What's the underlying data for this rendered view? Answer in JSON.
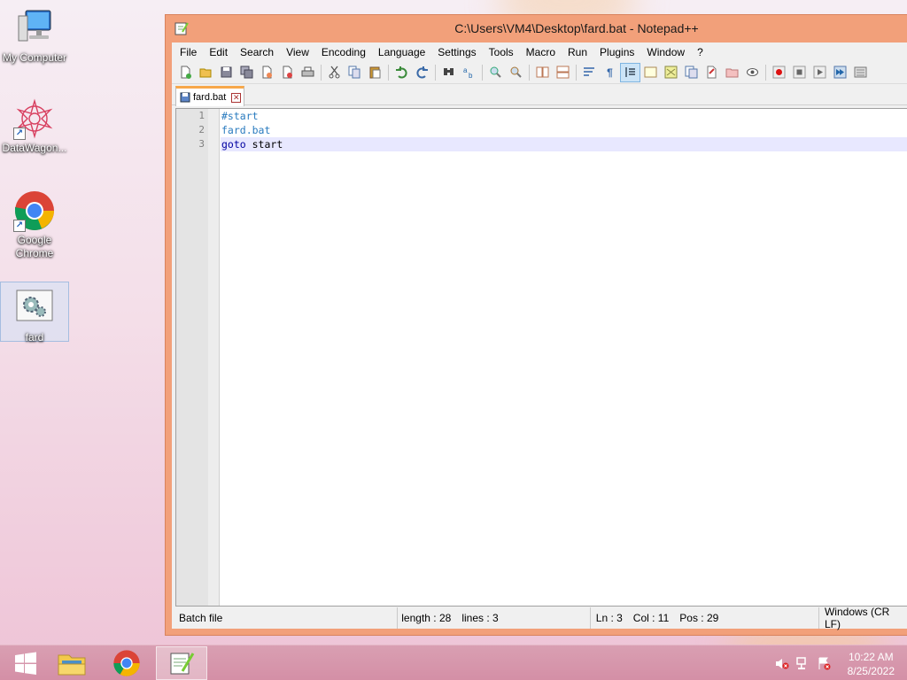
{
  "desktop": {
    "icons": [
      {
        "label": "My Computer"
      },
      {
        "label": "DataWagon..."
      },
      {
        "label": "Google Chrome"
      },
      {
        "label": "fard"
      }
    ]
  },
  "window": {
    "title": "C:\\Users\\VM4\\Desktop\\fard.bat - Notepad++",
    "menu": [
      "File",
      "Edit",
      "Search",
      "View",
      "Encoding",
      "Language",
      "Settings",
      "Tools",
      "Macro",
      "Run",
      "Plugins",
      "Window",
      "?"
    ],
    "tab": {
      "label": "fard.bat"
    },
    "lines": [
      {
        "number": "1",
        "text": "#start"
      },
      {
        "number": "2",
        "text": "fard.bat"
      },
      {
        "number": "3",
        "keyword": "goto",
        "text": " start"
      }
    ],
    "status": {
      "language": "Batch file",
      "length": "length : 28",
      "lines": "lines : 3",
      "ln": "Ln : 3",
      "col": "Col : 11",
      "pos": "Pos : 29",
      "eol": "Windows (CR LF)"
    }
  },
  "taskbar": {
    "time": "10:22 AM",
    "date": "8/25/2022"
  },
  "colors": {
    "accent": "#f2a07a",
    "label_blue": "#2a7bbf",
    "keyword_navy": "#0000a0",
    "current_line": "#e8e8ff"
  }
}
